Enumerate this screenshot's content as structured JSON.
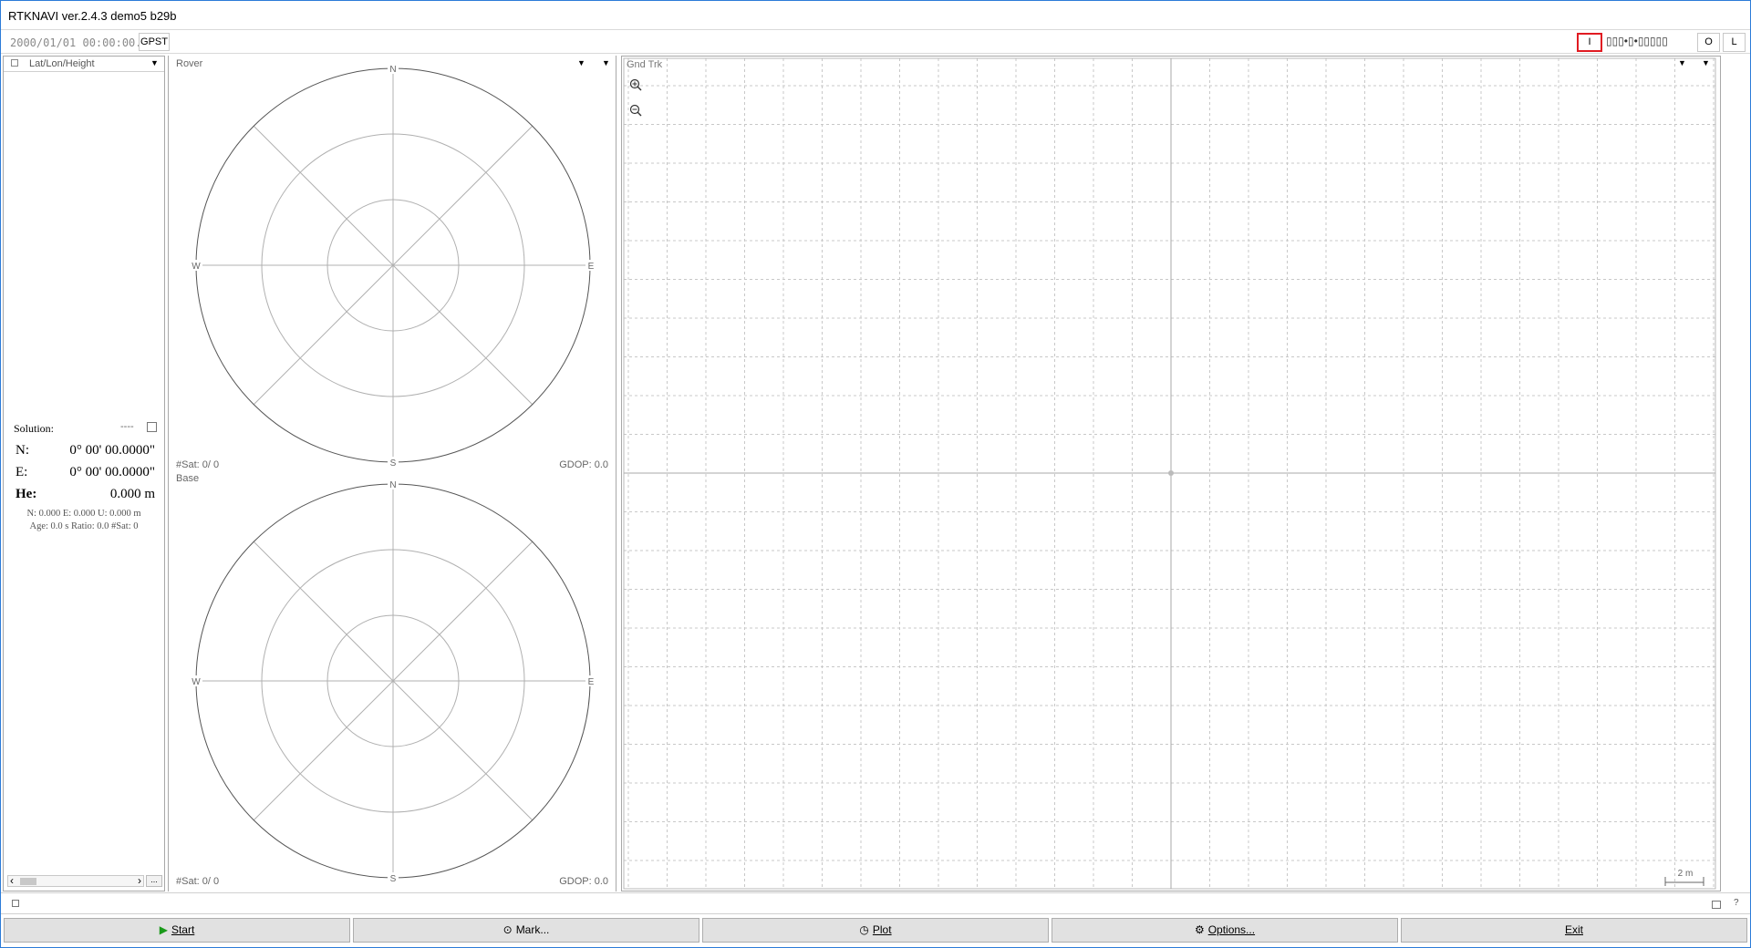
{
  "window": {
    "title": "RTKNAVI ver.2.4.3 demo5 b29b"
  },
  "toolbar": {
    "time": "2000/01/01 00:00:00.0",
    "time_system": "GPST",
    "btn_i": "I",
    "stream_status": "▯▯▯•▯•▯▯▯▯▯",
    "btn_o": "O",
    "btn_l": "L"
  },
  "solution_panel": {
    "mode": "Lat/Lon/Height",
    "solution_label": "Solution:",
    "solution_status": "----",
    "n_label": "N:",
    "n_value": "0° 00' 00.0000\"",
    "e_label": "E:",
    "e_value": "0° 00' 00.0000\"",
    "h_label": "He:",
    "h_value": "0.000 m",
    "stat_line1": "N: 0.000 E: 0.000 U: 0.000 m",
    "stat_line2": "Age: 0.0 s Ratio: 0.0 #Sat: 0",
    "more_label": "..."
  },
  "skyplots": [
    {
      "caption": "Rover",
      "sats": "#Sat: 0/ 0",
      "gdop": "GDOP: 0.0",
      "n": "N",
      "s": "S",
      "e": "E",
      "w": "W"
    },
    {
      "caption": "Base",
      "sats": "#Sat: 0/ 0",
      "gdop": "GDOP: 0.0",
      "n": "N",
      "s": "S",
      "e": "E",
      "w": "W"
    }
  ],
  "ground_track": {
    "title": "Gnd Trk",
    "scale": "2 m"
  },
  "buttons": {
    "start": "Start",
    "mark": "Mark...",
    "plot": "Plot",
    "options": "Options...",
    "exit": "Exit"
  },
  "status": {
    "help": "?"
  },
  "colors": {
    "accent_highlight": "#e11b22",
    "frame": "#2b7bd8",
    "start_icon": "#1a9a1a"
  }
}
